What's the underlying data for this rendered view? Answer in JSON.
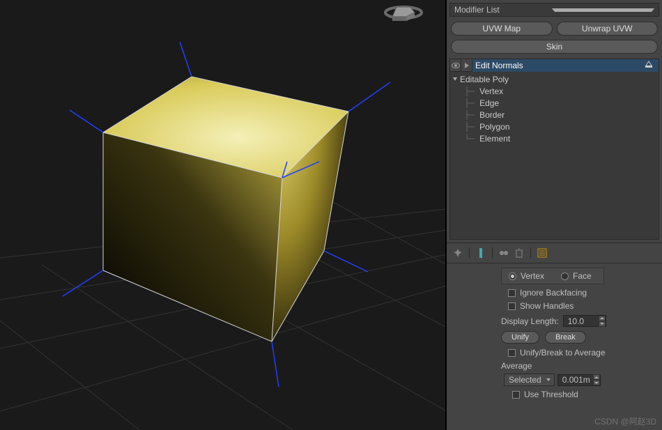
{
  "modifier_list_label": "Modifier List",
  "quick_buttons": {
    "uvw_map": "UVW Map",
    "unwrap_uvw": "Unwrap UVW",
    "skin": "Skin"
  },
  "stack": {
    "selected": "Edit Normals",
    "root": "Editable Poly",
    "sub": [
      "Vertex",
      "Edge",
      "Border",
      "Polygon",
      "Element"
    ]
  },
  "params": {
    "vertex": "Vertex",
    "face": "Face",
    "ignore_backfacing": "Ignore Backfacing",
    "show_handles": "Show Handles",
    "display_length_label": "Display Length:",
    "display_length_value": "10.0",
    "unify": "Unify",
    "break": "Break",
    "unify_break_avg": "Unify/Break to Average",
    "average": "Average",
    "selected": "Selected",
    "avg_dist": "0.001m",
    "use_threshold": "Use Threshold"
  },
  "watermark": "CSDN @阿赵3D"
}
